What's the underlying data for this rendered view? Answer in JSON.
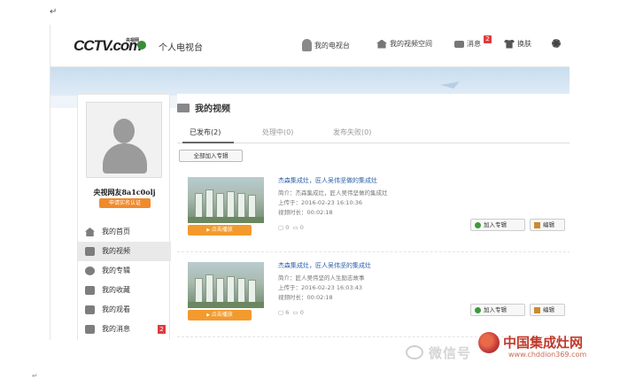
{
  "document": {
    "return_mark": "↵",
    "bottom_return_mark": "↵"
  },
  "header": {
    "logo_text": "CCTV.com",
    "logo_sub": "央视网",
    "site_title": "个人电视台",
    "nav": [
      {
        "label": "我的电视台",
        "icon": "person-icon"
      },
      {
        "label": "我的视频空间",
        "icon": "house-icon"
      },
      {
        "label": "消息",
        "icon": "mail-icon",
        "badge": "2"
      },
      {
        "label": "换肤",
        "icon": "shirt-icon"
      },
      {
        "label": "",
        "icon": "gear-icon"
      }
    ]
  },
  "sidebar": {
    "username": "央视网友8a1c0olj",
    "verify_label": "申请实名认证",
    "menu": [
      {
        "label": "我的首页",
        "icon": "home-icon",
        "active": false
      },
      {
        "label": "我的视频",
        "icon": "video-icon",
        "active": true
      },
      {
        "label": "我的专辑",
        "icon": "reel-icon",
        "active": false
      },
      {
        "label": "我的收藏",
        "icon": "collect-icon",
        "active": false
      },
      {
        "label": "我的观看",
        "icon": "watch-icon",
        "active": false
      },
      {
        "label": "我的消息",
        "icon": "message-icon",
        "active": false,
        "badge": "2"
      }
    ]
  },
  "main": {
    "section_title": "我的视频",
    "tabs": [
      {
        "label": "已发布(2)",
        "active": true
      },
      {
        "label": "处理中(0)",
        "active": false
      },
      {
        "label": "发布失败(0)",
        "active": false
      }
    ],
    "add_all_label": "全部加入专辑",
    "videos": [
      {
        "title": "杰森集成灶，匠人吴伟坚做的集成灶",
        "intro": "简介：杰森集成灶，匠人吴伟坚做的集成灶",
        "uploaded": "上传于：2016-02-23 16:10:36",
        "duration": "视频时长：00:02:18",
        "play_label": "点击播放",
        "views": "0",
        "comments": "0",
        "add_label": "加入专辑",
        "edit_label": "编辑"
      },
      {
        "title": "杰森集成灶，匠人吴伟坚的集成灶",
        "intro": "简介：匠人吴伟坚的人生励志故事",
        "uploaded": "上传于：2016-02-23 16:03:43",
        "duration": "视频时长：00:02:18",
        "play_label": "点击播放",
        "views": "6",
        "comments": "0",
        "add_label": "加入专辑",
        "edit_label": "编辑"
      }
    ]
  },
  "watermark": {
    "wechat_text": "微信号",
    "brand_name": "中国集成灶网",
    "brand_url": "www.chddion369.com"
  },
  "colors": {
    "accent_orange": "#f39a2d",
    "badge_red": "#e13a3a",
    "link_blue": "#2a5fa8",
    "brand_red": "#c0392b"
  }
}
